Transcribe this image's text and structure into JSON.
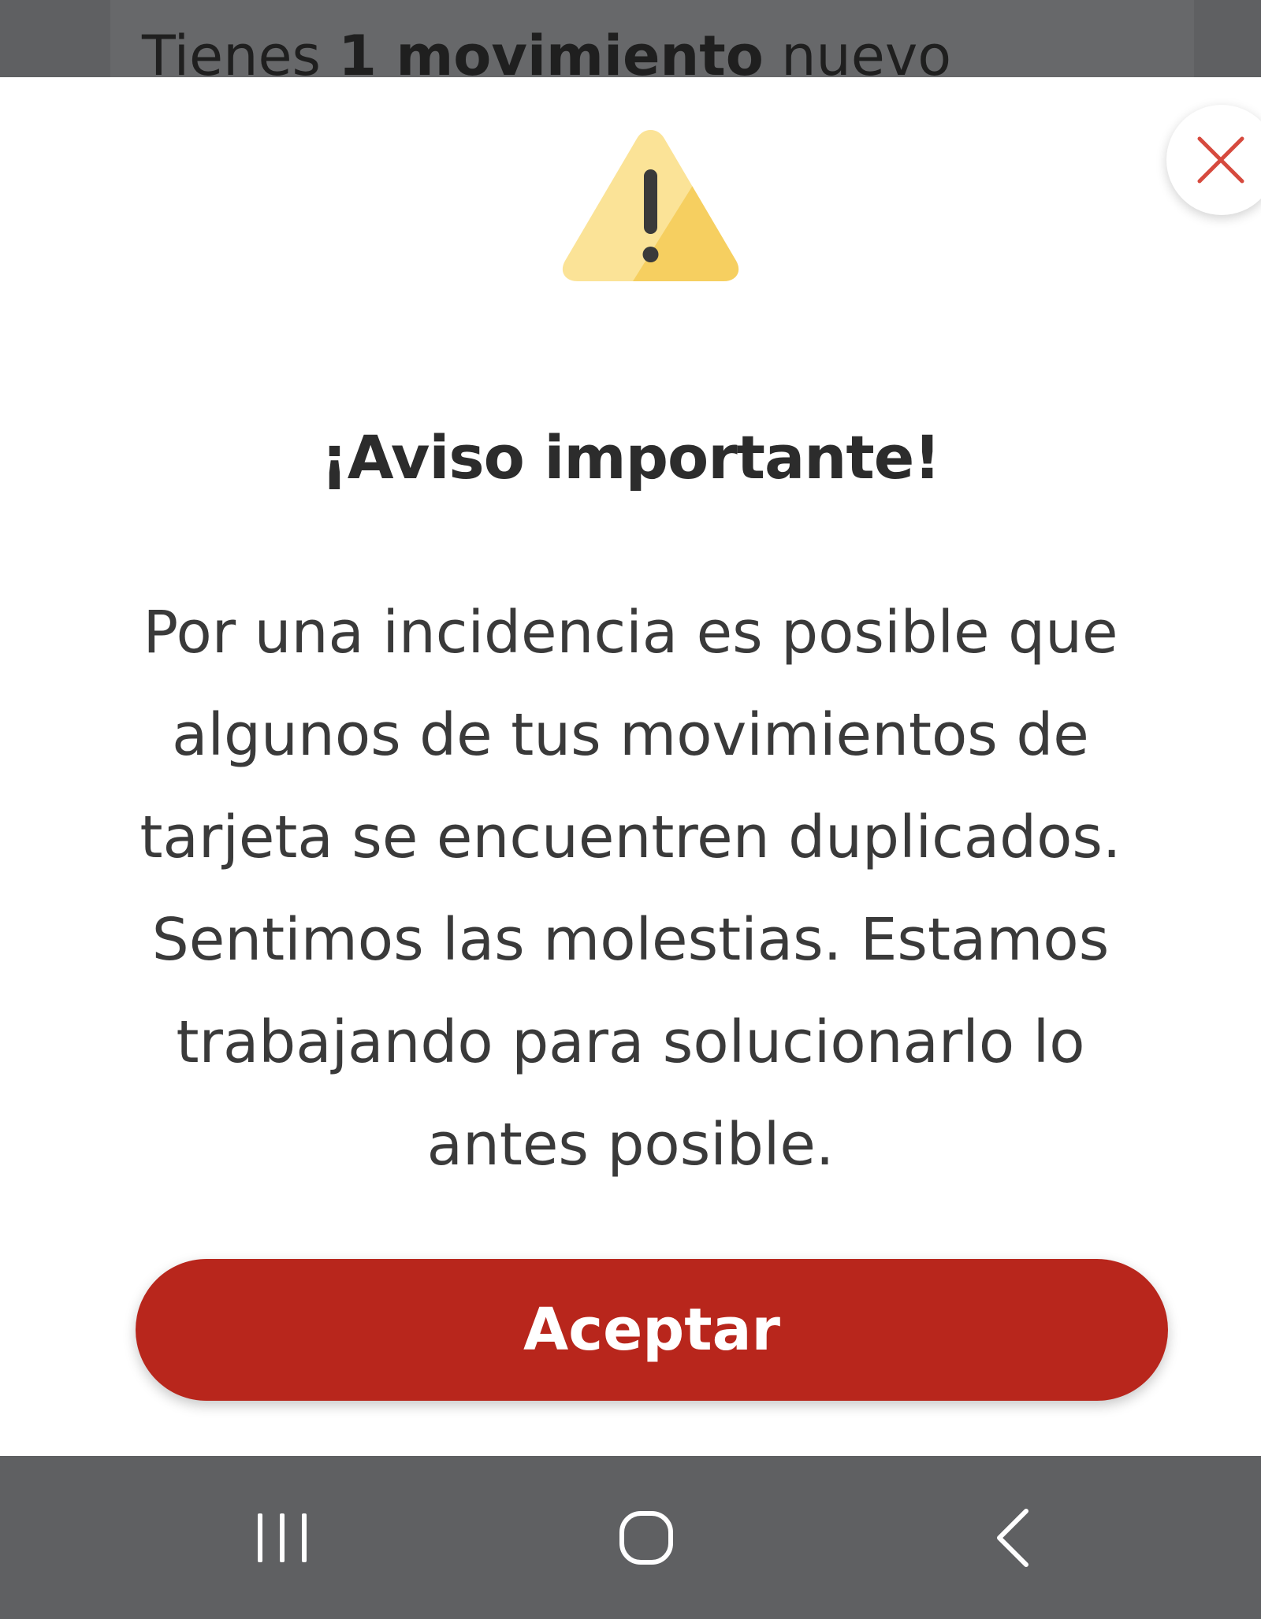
{
  "background": {
    "notice_prefix": "Tienes ",
    "notice_count": "1 movimiento",
    "notice_suffix": " nuevo"
  },
  "modal": {
    "close_icon": "close-icon",
    "warning_icon": "warning-triangle-icon",
    "title": "¡Aviso importante!",
    "message": "Por una incidencia es posible que algunos de tus movimientos de tarjeta se encuentren duplicados. Sentimos las molestias. Estamos trabajando para solucionarlo lo antes posible.",
    "accept_label": "Aceptar"
  },
  "navbar": {
    "recents_icon": "recents-icon",
    "home_icon": "home-icon",
    "back_icon": "back-icon"
  },
  "colors": {
    "accent": "#b8261c",
    "close_x": "#d64a3e",
    "warning_light": "#fbe397",
    "warning_dark": "#f6cf60",
    "overlay": "#5f6062"
  }
}
